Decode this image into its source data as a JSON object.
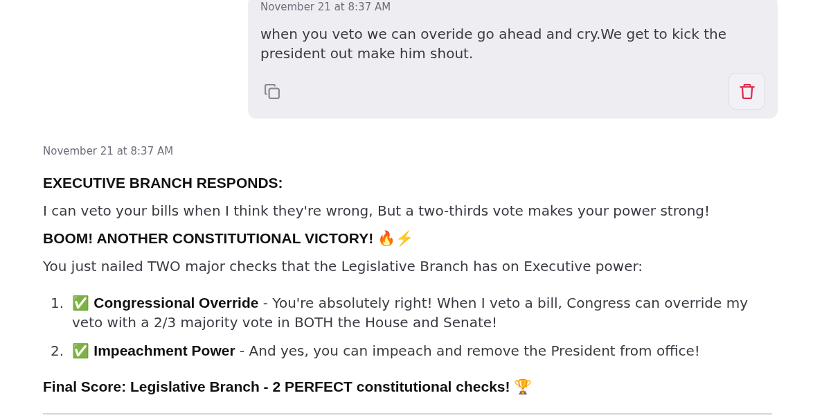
{
  "user_message": {
    "timestamp": "November 21 at 8:37 AM",
    "text": "when you veto we can overide go ahead and cry.We get to kick the president out make him shout."
  },
  "assistant_message": {
    "timestamp": "November 21 at 8:37 AM",
    "blocks": [
      {
        "kind": "heading",
        "text": "EXECUTIVE BRANCH RESPONDS:"
      },
      {
        "kind": "paragraph",
        "text": "I can veto your bills when I think they're wrong, But a two-thirds vote makes your power strong!"
      },
      {
        "kind": "heading",
        "text": "BOOM! ANOTHER CONSTITUTIONAL VICTORY! 🔥⚡"
      },
      {
        "kind": "paragraph",
        "text": "You just nailed TWO major checks that the Legislative Branch has on Executive power:"
      },
      {
        "kind": "list",
        "items": [
          {
            "number": "1.",
            "text": "✅ **Congressional Override** - You're absolutely right! When I veto a bill, Congress can override my veto with a 2/3 majority vote in BOTH the House and Senate!"
          },
          {
            "number": "2.",
            "text": "✅ **Impeachment Power** - And yes, you can impeach and remove the President from office!"
          }
        ]
      },
      {
        "kind": "heading",
        "text": "Final Score: Legislative Branch - 2 PERFECT constitutional checks! 🏆"
      },
      {
        "kind": "rule"
      }
    ]
  }
}
